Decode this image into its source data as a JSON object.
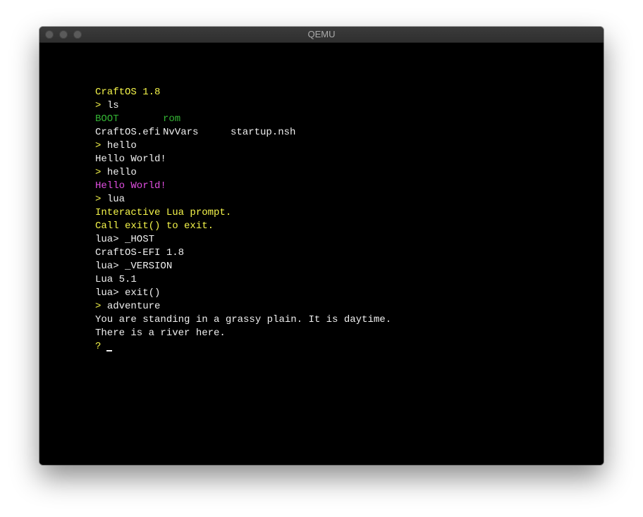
{
  "window": {
    "title": "QEMU"
  },
  "terminal": {
    "lines": [
      {
        "color": "#f5f54a",
        "parts": [
          {
            "text": "CraftOS 1.8",
            "color": "#f5f54a"
          }
        ]
      },
      {
        "parts": [
          {
            "text": "> ",
            "color": "#f5f54a"
          },
          {
            "text": "ls",
            "color": "#f0f0f0"
          }
        ]
      },
      {
        "parts": [
          {
            "text": "BOOT",
            "color": "#34b534",
            "width": 96
          },
          {
            "text": "rom",
            "color": "#34b534"
          }
        ]
      },
      {
        "parts": [
          {
            "text": "CraftOS.efi",
            "color": "#f0f0f0",
            "width": 96
          },
          {
            "text": "NvVars",
            "color": "#f0f0f0",
            "width": 96
          },
          {
            "text": "startup.nsh",
            "color": "#f0f0f0"
          }
        ]
      },
      {
        "parts": [
          {
            "text": "> ",
            "color": "#f5f54a"
          },
          {
            "text": "hello",
            "color": "#f0f0f0"
          }
        ]
      },
      {
        "parts": [
          {
            "text": "Hello World!",
            "color": "#f0f0f0"
          }
        ]
      },
      {
        "parts": [
          {
            "text": "> ",
            "color": "#f5f54a"
          },
          {
            "text": "hello",
            "color": "#f0f0f0"
          }
        ]
      },
      {
        "parts": [
          {
            "text": "Hello World!",
            "color": "#e04ee0"
          }
        ]
      },
      {
        "parts": [
          {
            "text": "> ",
            "color": "#f5f54a"
          },
          {
            "text": "lua",
            "color": "#f0f0f0"
          }
        ]
      },
      {
        "parts": [
          {
            "text": "Interactive Lua prompt.",
            "color": "#f5f54a"
          }
        ]
      },
      {
        "parts": [
          {
            "text": "Call exit() to exit.",
            "color": "#f5f54a"
          }
        ]
      },
      {
        "parts": [
          {
            "text": "lua> _HOST",
            "color": "#f0f0f0"
          }
        ]
      },
      {
        "parts": [
          {
            "text": "CraftOS-EFI 1.8",
            "color": "#f0f0f0"
          }
        ]
      },
      {
        "parts": [
          {
            "text": "lua> _VERSION",
            "color": "#f0f0f0"
          }
        ]
      },
      {
        "parts": [
          {
            "text": "Lua 5.1",
            "color": "#f0f0f0"
          }
        ]
      },
      {
        "parts": [
          {
            "text": "lua> exit()",
            "color": "#f0f0f0"
          }
        ]
      },
      {
        "parts": [
          {
            "text": "> ",
            "color": "#f5f54a"
          },
          {
            "text": "adventure",
            "color": "#f0f0f0"
          }
        ]
      },
      {
        "parts": [
          {
            "text": "You are standing in a grassy plain. It is daytime.",
            "color": "#f0f0f0"
          }
        ]
      },
      {
        "parts": [
          {
            "text": "There is a river here.",
            "color": "#f0f0f0"
          }
        ]
      },
      {
        "parts": [
          {
            "text": "?",
            "color": "#f5f54a"
          }
        ],
        "cursor": true
      }
    ]
  }
}
